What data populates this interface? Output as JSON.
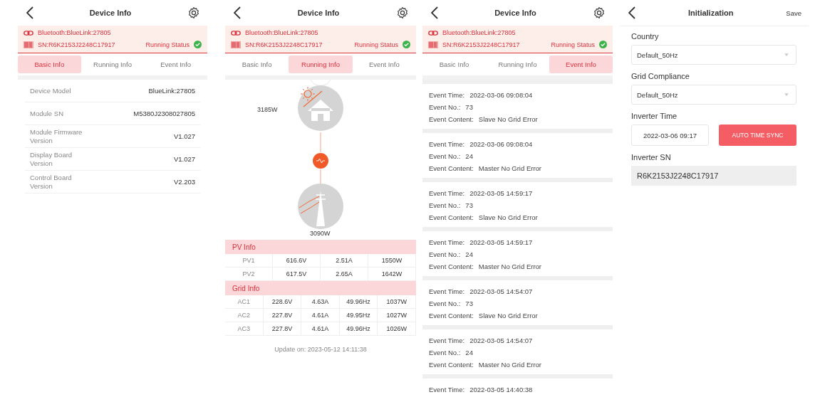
{
  "screens": [
    {
      "kind": "basic",
      "title": "Device Info",
      "bluetooth": "Bluetooth:BlueLink:27805",
      "sn": "SN:R6K2153J2248C17917",
      "status": "Running Status",
      "tabs": [
        {
          "label": "Basic Info",
          "selected": true
        },
        {
          "label": "Running Info",
          "selected": false
        },
        {
          "label": "Event Info",
          "selected": false
        }
      ],
      "rows": [
        {
          "label": "Device Model",
          "value": "BlueLink:27805"
        },
        {
          "label": "Module SN",
          "value": "M5380J2308027805"
        },
        {
          "label": "Module Firmware Version",
          "value": "V1.027"
        },
        {
          "label": "Display Board Version",
          "value": "V1.027"
        },
        {
          "label": "Control Board Version",
          "value": "V2.203"
        }
      ]
    },
    {
      "kind": "running",
      "title": "Device Info",
      "bluetooth": "Bluetooth:BlueLink:27805",
      "sn": "SN:R6K2153J2248C17917",
      "status": "Running Status",
      "tabs": [
        {
          "label": "Basic Info",
          "selected": false
        },
        {
          "label": "Running Info",
          "selected": true
        },
        {
          "label": "Event Info",
          "selected": false
        }
      ],
      "flow": {
        "pv_power": "3185W",
        "grid_power": "3090W"
      },
      "tables": [
        {
          "title": "PV Info",
          "rows": [
            [
              "PV1",
              "616.6V",
              "2.51A",
              "1550W"
            ],
            [
              "PV2",
              "617.5V",
              "2.65A",
              "1642W"
            ]
          ]
        },
        {
          "title": "Grid Info",
          "rows": [
            [
              "AC1",
              "228.6V",
              "4.63A",
              "49.96Hz",
              "1037W"
            ],
            [
              "AC2",
              "227.8V",
              "4.61A",
              "49.95Hz",
              "1027W"
            ],
            [
              "AC3",
              "227.8V",
              "4.61A",
              "49.96Hz",
              "1026W"
            ]
          ]
        }
      ],
      "update": "Update on: 2023-05-12 14:11:38"
    },
    {
      "kind": "events",
      "title": "Device Info",
      "bluetooth": "Bluetooth:BlueLink:27805",
      "sn": "SN:R6K2153J2248C17917",
      "status": "Running Status",
      "tabs": [
        {
          "label": "Basic Info",
          "selected": false
        },
        {
          "label": "Running Info",
          "selected": false
        },
        {
          "label": "Event Info",
          "selected": true
        }
      ],
      "events": [
        {
          "lines": [
            {
              "label": "Event Time:",
              "value": "2022-03-06 09:08:04"
            },
            {
              "label": "Event No.:",
              "value": "73"
            },
            {
              "label": "Event Content:",
              "value": "Slave No Grid Error"
            }
          ]
        },
        {
          "lines": [
            {
              "label": "Event Time:",
              "value": "2022-03-06 09:08:04"
            },
            {
              "label": "Event No.:",
              "value": "24"
            },
            {
              "label": "Event Content:",
              "value": "Master No Grid Error"
            }
          ]
        },
        {
          "lines": [
            {
              "label": "Event Time:",
              "value": "2022-03-05 14:59:17"
            },
            {
              "label": "Event No.:",
              "value": "73"
            },
            {
              "label": "Event Content:",
              "value": "Slave No Grid Error"
            }
          ]
        },
        {
          "lines": [
            {
              "label": "Event Time:",
              "value": "2022-03-05 14:59:17"
            },
            {
              "label": "Event No.:",
              "value": "24"
            },
            {
              "label": "Event Content:",
              "value": "Master No Grid Error"
            }
          ]
        },
        {
          "lines": [
            {
              "label": "Event Time:",
              "value": "2022-03-05 14:54:07"
            },
            {
              "label": "Event No.:",
              "value": "73"
            },
            {
              "label": "Event Content:",
              "value": "Slave No Grid Error"
            }
          ]
        },
        {
          "lines": [
            {
              "label": "Event Time:",
              "value": "2022-03-05 14:54:07"
            },
            {
              "label": "Event No.:",
              "value": "24"
            },
            {
              "label": "Event Content:",
              "value": "Master No Grid Error"
            }
          ]
        },
        {
          "lines": [
            {
              "label": "Event Time:",
              "value": "2022-03-05 14:40:38"
            }
          ]
        }
      ]
    },
    {
      "kind": "init",
      "title": "Initialization",
      "save": "Save",
      "fields": [
        {
          "kind": "select",
          "label": "Country",
          "value": "Default_50Hz"
        },
        {
          "kind": "select",
          "label": "Grid Compliance",
          "value": "Default_50Hz"
        },
        {
          "kind": "time",
          "label": "Inverter Time",
          "value": "2022-03-06 09:17",
          "button": "AUTO TIME SYNC"
        },
        {
          "kind": "readonly",
          "label": "Inverter SN",
          "value": "R6K2153J2248C17917"
        }
      ]
    }
  ]
}
